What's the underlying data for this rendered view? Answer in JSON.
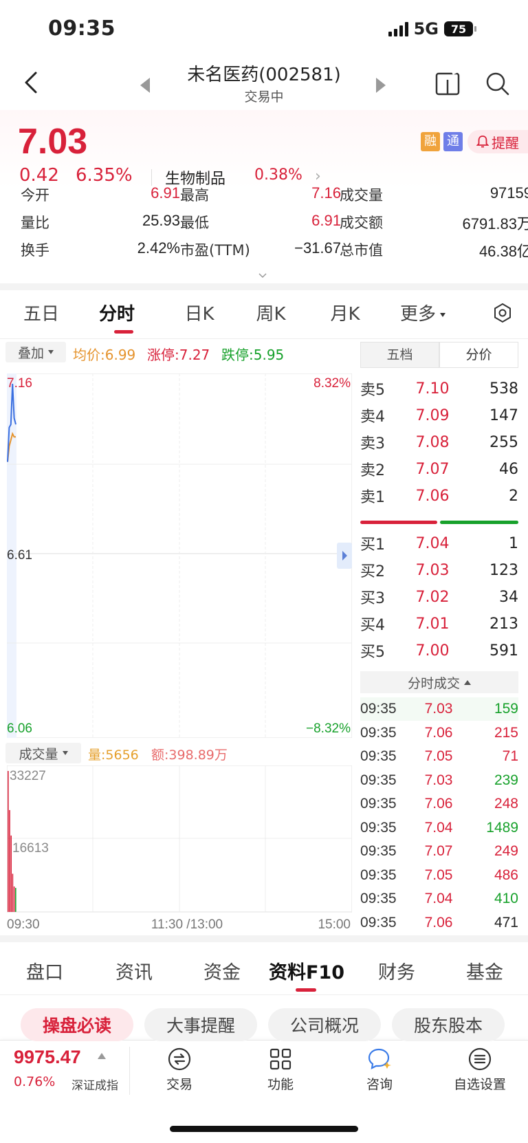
{
  "status": {
    "time": "09:35",
    "network": "5G",
    "battery": "75"
  },
  "header": {
    "title": "未名医药(002581)",
    "subtitle": "交易中"
  },
  "quote": {
    "price": "7.03",
    "change": "0.42",
    "change_pct": "6.35%",
    "sector": "生物制品",
    "sector_pct": "0.38%",
    "tag_rong": "融",
    "tag_tong": "通",
    "remind_label": "提醒"
  },
  "stats": [
    [
      {
        "label": "今开",
        "value": "6.91",
        "color": "red"
      },
      {
        "label": "最高",
        "value": "7.16",
        "color": "red"
      },
      {
        "label": "成交量",
        "value": "97159",
        "color": "black"
      }
    ],
    [
      {
        "label": "量比",
        "value": "25.93",
        "color": "black"
      },
      {
        "label": "最低",
        "value": "6.91",
        "color": "red"
      },
      {
        "label": "成交额",
        "value": "6791.83万",
        "color": "black"
      }
    ],
    [
      {
        "label": "换手",
        "value": "2.42%",
        "color": "black"
      },
      {
        "label": "市盈(TTM)",
        "value": "−31.67",
        "color": "black"
      },
      {
        "label": "总市值",
        "value": "46.38亿",
        "color": "black"
      }
    ]
  ],
  "chart_tabs": [
    "五日",
    "分时",
    "日K",
    "周K",
    "月K",
    "更多"
  ],
  "overlay": {
    "button": "叠加",
    "avg": "均价:6.99",
    "limit_up": "涨停:7.27",
    "limit_down": "跌停:5.95"
  },
  "chart_labels": {
    "top_price": "7.16",
    "mid_price": "6.61",
    "bottom_price": "6.06",
    "top_pct": "8.32%",
    "bottom_pct": "−8.32%",
    "vol_top": "33227",
    "vol_mid": "16613",
    "time_start": "09:30",
    "time_mid": "11:30 /13:00",
    "time_end": "15:00"
  },
  "volume_bar": {
    "button": "成交量",
    "amount": "量:5656",
    "turnover": "额:398.89万"
  },
  "chart_data": {
    "type": "line",
    "x": [
      "09:30",
      "09:31",
      "09:32",
      "09:33",
      "09:34",
      "09:35"
    ],
    "series": [
      {
        "values": [
          6.91,
          7.02,
          7.03,
          7.16,
          7.05,
          7.03
        ],
        "color": "#3a6fe0"
      },
      {
        "values": [
          6.91,
          6.96,
          6.98,
          7.0,
          6.99,
          6.99
        ],
        "color": "#e5932d"
      }
    ],
    "ylim": [
      6.06,
      7.16
    ],
    "volumes": [
      33227,
      24000,
      18000,
      9000,
      6000,
      5656
    ]
  },
  "orderbook": {
    "tabs": [
      "五档",
      "分价"
    ],
    "sells": [
      {
        "label": "卖5",
        "price": "7.10",
        "qty": "538"
      },
      {
        "label": "卖4",
        "price": "7.09",
        "qty": "147"
      },
      {
        "label": "卖3",
        "price": "7.08",
        "qty": "255"
      },
      {
        "label": "卖2",
        "price": "7.07",
        "qty": "46"
      },
      {
        "label": "卖1",
        "price": "7.06",
        "qty": "2"
      }
    ],
    "buys": [
      {
        "label": "买1",
        "price": "7.04",
        "qty": "1"
      },
      {
        "label": "买2",
        "price": "7.03",
        "qty": "123"
      },
      {
        "label": "买3",
        "price": "7.02",
        "qty": "34"
      },
      {
        "label": "买4",
        "price": "7.01",
        "qty": "213"
      },
      {
        "label": "买5",
        "price": "7.00",
        "qty": "591"
      }
    ],
    "trades_header": "分时成交",
    "trades": [
      {
        "time": "09:35",
        "price": "7.03",
        "vol": "159",
        "color": "green"
      },
      {
        "time": "09:35",
        "price": "7.06",
        "vol": "215",
        "color": "red"
      },
      {
        "time": "09:35",
        "price": "7.05",
        "vol": "71",
        "color": "red"
      },
      {
        "time": "09:35",
        "price": "7.03",
        "vol": "239",
        "color": "green"
      },
      {
        "time": "09:35",
        "price": "7.06",
        "vol": "248",
        "color": "red"
      },
      {
        "time": "09:35",
        "price": "7.04",
        "vol": "1489",
        "color": "green"
      },
      {
        "time": "09:35",
        "price": "7.07",
        "vol": "249",
        "color": "red"
      },
      {
        "time": "09:35",
        "price": "7.05",
        "vol": "486",
        "color": "red"
      },
      {
        "time": "09:35",
        "price": "7.04",
        "vol": "410",
        "color": "green"
      },
      {
        "time": "09:35",
        "price": "7.06",
        "vol": "471",
        "color": "black"
      }
    ]
  },
  "info_tabs": [
    "盘口",
    "资讯",
    "资金",
    "资料F10",
    "财务",
    "基金"
  ],
  "sub_tabs": [
    "操盘必读",
    "大事提醒",
    "公司概况",
    "股东股本"
  ],
  "index": {
    "value": "9975.47",
    "pct": "0.76%",
    "name": "深证成指"
  },
  "toolbar": [
    {
      "label": "交易",
      "icon": "trade-icon"
    },
    {
      "label": "功能",
      "icon": "grid-icon"
    },
    {
      "label": "咨询",
      "icon": "chat-icon"
    },
    {
      "label": "自选设置",
      "icon": "menu-icon"
    }
  ],
  "colors": {
    "up": "#d8213a",
    "down": "#17a12b",
    "avg": "#e5932d",
    "line": "#3a6fe0"
  }
}
